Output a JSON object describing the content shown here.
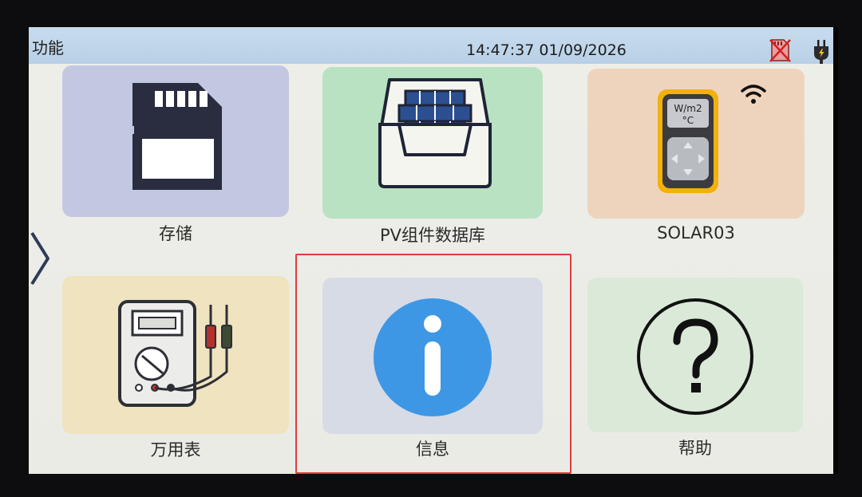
{
  "header": {
    "title": "功能",
    "datetime": "14:47:37 01/09/2026",
    "sd_status_icon": "sd-card-missing-icon",
    "power_status_icon": "power-plug-icon"
  },
  "tiles": [
    {
      "label": "存储",
      "icon": "sd-card-icon",
      "color": "#c3c8e2"
    },
    {
      "label": "PV组件数据库",
      "icon": "pv-module-database-icon",
      "color": "#b9e2c2"
    },
    {
      "label": "SOLAR03",
      "icon": "solar03-meter-icon",
      "color": "#efd4bd",
      "meter_unit_line1": "W/m2",
      "meter_unit_line2": "°C"
    },
    {
      "label": "万用表",
      "icon": "multimeter-icon",
      "color": "#efe3c0"
    },
    {
      "label": "信息",
      "icon": "info-icon",
      "color": "#d6dbe6"
    },
    {
      "label": "帮助",
      "icon": "help-icon",
      "color": "#dbe9d8"
    }
  ],
  "highlight_color": "#e23b3b",
  "accent_blue": "#3d97e4"
}
